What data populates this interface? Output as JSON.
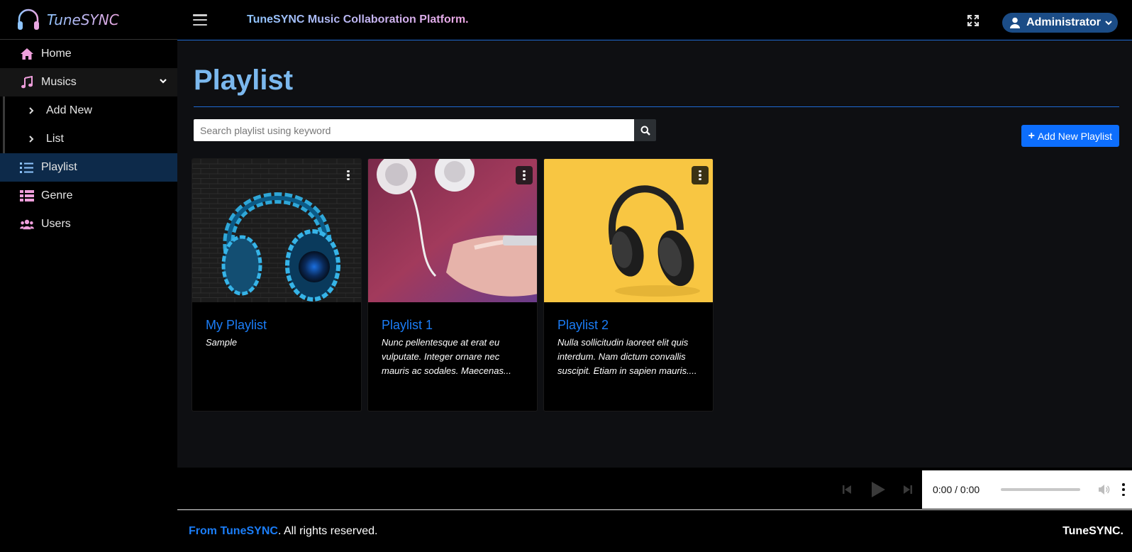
{
  "brand": {
    "name": "TuneSYNC"
  },
  "sidebar": {
    "items": [
      {
        "label": "Home",
        "icon": "home-icon"
      },
      {
        "label": "Musics",
        "icon": "music-icon"
      },
      {
        "label": "Add New",
        "icon": "chevron-right-icon"
      },
      {
        "label": "List",
        "icon": "chevron-right-icon"
      },
      {
        "label": "Playlist",
        "icon": "list-icon"
      },
      {
        "label": "Genre",
        "icon": "table-list-icon"
      },
      {
        "label": "Users",
        "icon": "users-icon"
      }
    ]
  },
  "topbar": {
    "title": "TuneSYNC Music Collaboration Platform.",
    "user_label": "Administrator"
  },
  "main": {
    "page_title": "Playlist",
    "search": {
      "placeholder": "Search playlist using keyword"
    },
    "add_button_label": "Add New Playlist",
    "cards": [
      {
        "title": "My Playlist",
        "description": "Sample"
      },
      {
        "title": "Playlist 1",
        "description": "Nunc pellentesque at erat eu vulputate. Integer ornare nec mauris ac sodales. Maecenas..."
      },
      {
        "title": "Playlist 2",
        "description": "Nulla sollicitudin laoreet elit quis interdum. Nam dictum convallis suscipit. Etiam in sapien mauris...."
      }
    ]
  },
  "player": {
    "time": "0:00 / 0:00"
  },
  "footer": {
    "brand": "From TuneSYNC",
    "rights": ". All rights reserved.",
    "right_text": "TuneSYNC."
  },
  "colors": {
    "accent": "#1b7df7",
    "active_nav": "#0d2a4a",
    "title": "#7bb8ee"
  }
}
